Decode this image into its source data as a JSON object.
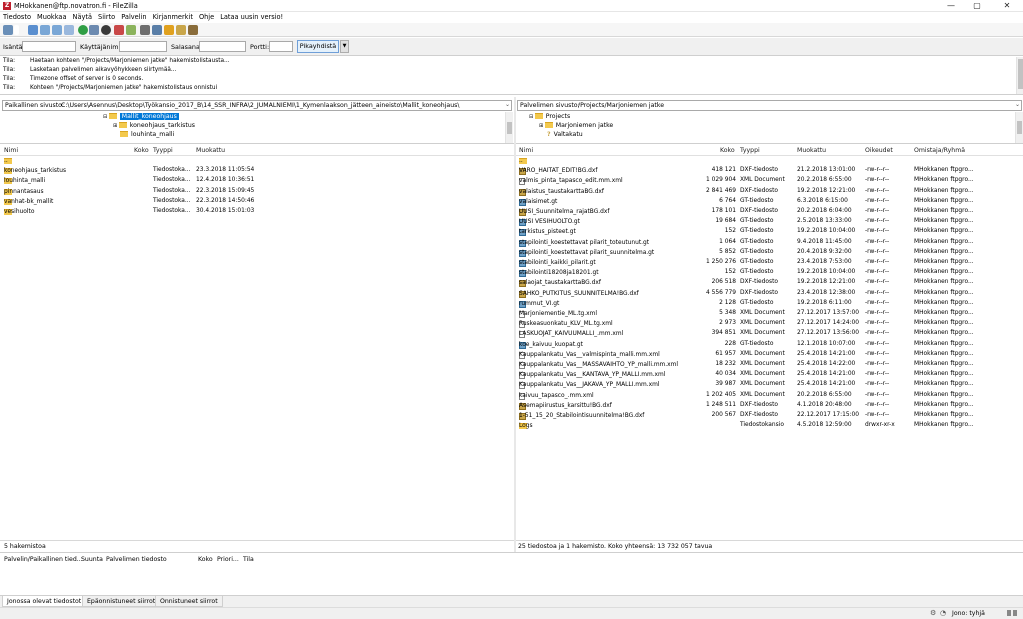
{
  "window": {
    "title": "MHokkanen@ftp.novatron.fi - FileZilla",
    "app_icon": "Z",
    "minimize": "—",
    "maximize": "▢",
    "close": "✕"
  },
  "menu": [
    "Tiedosto",
    "Muokkaa",
    "Näytä",
    "Siirto",
    "Palvelin",
    "Kirjanmerkit",
    "Ohje",
    "Lataa uusin versio!"
  ],
  "quickconnect": {
    "host_label": "Isäntä:",
    "user_label": "Käyttäjänimi:",
    "pass_label": "Salasana:",
    "port_label": "Portti:",
    "button": "Pikayhdistä",
    "dropdown": "▼"
  },
  "log": [
    {
      "k": "Tila:",
      "v": "Haetaan kohteen \"/Projects/Marjoniemen jatke\" hakemistolistausta..."
    },
    {
      "k": "Tila:",
      "v": "Lasketaan palvelimen aikavyöhykkeen siirtymää..."
    },
    {
      "k": "Tila:",
      "v": "Timezone offset of server is 0 seconds."
    },
    {
      "k": "Tila:",
      "v": "Kohteen \"/Projects/Marjoniemen jatke\" hakemistolistaus onnistui"
    }
  ],
  "local": {
    "site_label": "Paikallinen sivusto:",
    "path": "C:\\Users\\Asennus\\Desktop\\Työkansio_2017_B\\14_SSR_INFRA\\2_JUMALNIEMI\\1_Kymenlaakson_jätteen_aineisto\\Mallit_koneohjaus\\",
    "tree": [
      {
        "label": "Mallit_koneohjaus",
        "selected": true
      },
      {
        "label": "koneohjaus_tarkistus",
        "selected": false
      },
      {
        "label": "louhinta_malli",
        "selected": false
      }
    ],
    "columns": {
      "name": "Nimi",
      "size": "Koko",
      "type": "Tyyppi",
      "modified": "Muokattu"
    },
    "files": [
      {
        "name": "..",
        "size": "",
        "type": "",
        "modified": "",
        "icon": "folder"
      },
      {
        "name": "koneohjaus_tarkistus",
        "size": "",
        "type": "Tiedostoka...",
        "modified": "23.3.2018 11:05:54",
        "icon": "folder"
      },
      {
        "name": "louhinta_malli",
        "size": "",
        "type": "Tiedostoka...",
        "modified": "12.4.2018 10:36:51",
        "icon": "folder"
      },
      {
        "name": "pinnantasaus",
        "size": "",
        "type": "Tiedostoka...",
        "modified": "22.3.2018 15:09:45",
        "icon": "folder"
      },
      {
        "name": "vanhat-bk_mallit",
        "size": "",
        "type": "Tiedostoka...",
        "modified": "22.3.2018 14:50:46",
        "icon": "folder"
      },
      {
        "name": "vesihuolto",
        "size": "",
        "type": "Tiedostoka...",
        "modified": "30.4.2018 15:01:03",
        "icon": "folder"
      }
    ],
    "status": "5 hakemistoa"
  },
  "remote": {
    "site_label": "Palvelimen sivusto:",
    "path": "/Projects/Marjoniemen jatke",
    "tree": [
      {
        "label": "Projects",
        "selected": false
      },
      {
        "label": "Marjoniemen jatke",
        "selected": false
      },
      {
        "label": "Valtakatu",
        "selected": false
      }
    ],
    "columns": {
      "name": "Nimi",
      "size": "Koko",
      "type": "Tyyppi",
      "modified": "Muokattu",
      "perms": "Oikeudet",
      "owner": "Omistaja/Ryhmä"
    },
    "files": [
      {
        "name": "..",
        "size": "",
        "type": "",
        "modified": "",
        "perms": "",
        "owner": "",
        "icon": "folder"
      },
      {
        "name": "VARO_HAITAT_EDIT!BG.dxf",
        "size": "418 121",
        "type": "DXF-tiedosto",
        "modified": "21.2.2018 13:01:00",
        "perms": "-rw-r--r--",
        "owner": "MHokkanen ftpgro...",
        "icon": "dxf"
      },
      {
        "name": "valmis_pinta_tapasco_edit.mm.xml",
        "size": "1 029 904",
        "type": "XML Document",
        "modified": "20.2.2018 6:55:00",
        "perms": "-rw-r--r--",
        "owner": "MHokkanen ftpgro...",
        "icon": "file"
      },
      {
        "name": "valaistus_taustakarttaBG.dxf",
        "size": "2 841 469",
        "type": "DXF-tiedosto",
        "modified": "19.2.2018 12:21:00",
        "perms": "-rw-r--r--",
        "owner": "MHokkanen ftpgro...",
        "icon": "dxf"
      },
      {
        "name": "valaisimet.gt",
        "size": "6 764",
        "type": "GT-tiedosto",
        "modified": "6.3.2018 6:15:00",
        "perms": "-rw-r--r--",
        "owner": "MHokkanen ftpgro...",
        "icon": "gt"
      },
      {
        "name": "UUSI_Suunnitelma_rajatBG.dxf",
        "size": "178 101",
        "type": "DXF-tiedosto",
        "modified": "20.2.2018 6:04:00",
        "perms": "-rw-r--r--",
        "owner": "MHokkanen ftpgro...",
        "icon": "dxf"
      },
      {
        "name": "UUSI VESIHUOLTO.gt",
        "size": "19 684",
        "type": "GT-tiedosto",
        "modified": "2.5.2018 13:33:00",
        "perms": "-rw-r--r--",
        "owner": "MHokkanen ftpgro...",
        "icon": "gt"
      },
      {
        "name": "tarkistus_pisteet.gt",
        "size": "152",
        "type": "GT-tiedosto",
        "modified": "19.2.2018 10:04:00",
        "perms": "-rw-r--r--",
        "owner": "MHokkanen ftpgro...",
        "icon": "gt"
      },
      {
        "name": "stapilointi_koestettavat pilarit_toteutunut.gt",
        "size": "1 064",
        "type": "GT-tiedosto",
        "modified": "9.4.2018 11:45:00",
        "perms": "-rw-r--r--",
        "owner": "MHokkanen ftpgro...",
        "icon": "gt"
      },
      {
        "name": "stapilointi_koestettavat pilarit_suunnitelma.gt",
        "size": "5 852",
        "type": "GT-tiedosto",
        "modified": "20.4.2018 9:32:00",
        "perms": "-rw-r--r--",
        "owner": "MHokkanen ftpgro...",
        "icon": "gt"
      },
      {
        "name": "stabilointi_kaikki_pilarit.gt",
        "size": "1 250 276",
        "type": "GT-tiedosto",
        "modified": "23.4.2018 7:53:00",
        "perms": "-rw-r--r--",
        "owner": "MHokkanen ftpgro...",
        "icon": "gt"
      },
      {
        "name": "stabilointi18208ja18201.gt",
        "size": "152",
        "type": "GT-tiedosto",
        "modified": "19.2.2018 10:04:00",
        "perms": "-rw-r--r--",
        "owner": "MHokkanen ftpgro...",
        "icon": "gt"
      },
      {
        "name": "salaojat_taustakarttaBG.dxf",
        "size": "206 518",
        "type": "DXF-tiedosto",
        "modified": "19.2.2018 12:21:00",
        "perms": "-rw-r--r--",
        "owner": "MHokkanen ftpgro...",
        "icon": "dxf"
      },
      {
        "name": "SAHKO_PUTKITUS_SUUNNITELMA!BG.dxf",
        "size": "4 556 779",
        "type": "DXF-tiedosto",
        "modified": "23.4.2018 12:38:00",
        "perms": "-rw-r--r--",
        "owner": "MHokkanen ftpgro...",
        "icon": "dxf"
      },
      {
        "name": "rummut_VI.gt",
        "size": "2 128",
        "type": "GT-tiedosto",
        "modified": "19.2.2018 6:11:00",
        "perms": "-rw-r--r--",
        "owner": "MHokkanen ftpgro...",
        "icon": "gt"
      },
      {
        "name": "Marjoniementie_ML.tg.xml",
        "size": "5 348",
        "type": "XML Document",
        "modified": "27.12.2017 13:57:00",
        "perms": "-rw-r--r--",
        "owner": "MHokkanen ftpgro...",
        "icon": "file"
      },
      {
        "name": "Ruskeasuonkatu_KLV_ML.tg.xml",
        "size": "2 973",
        "type": "XML Document",
        "modified": "27.12.2017 14:24:00",
        "perms": "-rw-r--r--",
        "owner": "MHokkanen ftpgro...",
        "icon": "file"
      },
      {
        "name": "LASKUOJAT_KAIVUUMALLI_.mm.xml",
        "size": "394 851",
        "type": "XML Document",
        "modified": "27.12.2017 13:56:00",
        "perms": "-rw-r--r--",
        "owner": "MHokkanen ftpgro...",
        "icon": "file"
      },
      {
        "name": "koe_kaivuu_kuopat.gt",
        "size": "228",
        "type": "GT-tiedosto",
        "modified": "12.1.2018 10:07:00",
        "perms": "-rw-r--r--",
        "owner": "MHokkanen ftpgro...",
        "icon": "gt"
      },
      {
        "name": "Kauppalankatu_Vas__valmispinta_malli.mm.xml",
        "size": "61 957",
        "type": "XML Document",
        "modified": "25.4.2018 14:21:00",
        "perms": "-rw-r--r--",
        "owner": "MHokkanen ftpgro...",
        "icon": "file"
      },
      {
        "name": "Kauppalankatu_Vas__MASSAVAIHTO_YP_malli.mm.xml",
        "size": "18 232",
        "type": "XML Document",
        "modified": "25.4.2018 14:22:00",
        "perms": "-rw-r--r--",
        "owner": "MHokkanen ftpgro...",
        "icon": "file"
      },
      {
        "name": "Kauppalankatu_Vas__KANTAVA_YP_MALLI.mm.xml",
        "size": "40 034",
        "type": "XML Document",
        "modified": "25.4.2018 14:21:00",
        "perms": "-rw-r--r--",
        "owner": "MHokkanen ftpgro...",
        "icon": "file"
      },
      {
        "name": "Kauppalankatu_Vas__JAKAVA_YP_MALLI.mm.xml",
        "size": "39 987",
        "type": "XML Document",
        "modified": "25.4.2018 14:21:00",
        "perms": "-rw-r--r--",
        "owner": "MHokkanen ftpgro...",
        "icon": "file"
      },
      {
        "name": "kaivuu_tapasco_.mm.xml",
        "size": "1 202 405",
        "type": "XML Document",
        "modified": "20.2.2018 6:55:00",
        "perms": "-rw-r--r--",
        "owner": "MHokkanen ftpgro...",
        "icon": "file"
      },
      {
        "name": "Asemapiirustus_karsittu!BG.dxf",
        "size": "1 248 511",
        "type": "DXF-tiedosto",
        "modified": "4.1.2018 20:48:00",
        "perms": "-rw-r--r--",
        "owner": "MHokkanen ftpgro...",
        "icon": "dxf"
      },
      {
        "name": "1-51_15_20_Stabilointisuunnitelma!BG.dxf",
        "size": "200 567",
        "type": "DXF-tiedosto",
        "modified": "22.12.2017 17:15:00",
        "perms": "-rw-r--r--",
        "owner": "MHokkanen ftpgro...",
        "icon": "dxf"
      },
      {
        "name": "Logs",
        "size": "",
        "type": "Tiedostokansio",
        "modified": "4.5.2018 12:59:00",
        "perms": "drwxr-xr-x",
        "owner": "MHokkanen ftpgro...",
        "icon": "folder"
      }
    ],
    "status": "25 tiedostoa ja 1 hakemisto. Koko yhteensä: 13 732 057 tavua"
  },
  "queue": {
    "columns": [
      "Palvelin/Paikallinen tied...",
      "Suunta",
      "Palvelimen tiedosto",
      "Koko",
      "Priori...",
      "Tila"
    ]
  },
  "tabs": [
    "Jonossa olevat tiedostot",
    "Epäonnistuneet siirrot",
    "Onnistuneet siirrot"
  ],
  "queue_status": "Jono: tyhjä"
}
